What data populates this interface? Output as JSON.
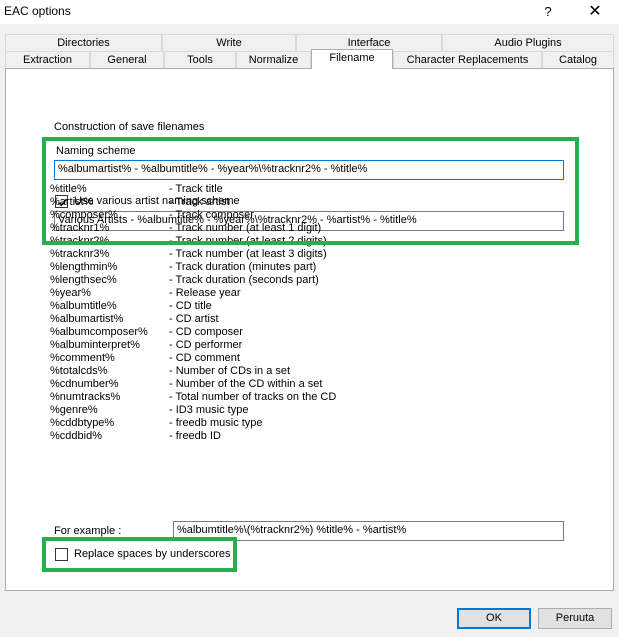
{
  "window": {
    "title": "EAC options",
    "help": "?",
    "close": "✕"
  },
  "tabs_top": [
    "Directories",
    "Write",
    "Interface",
    "Audio Plugins"
  ],
  "tabs_bottom": [
    "Extraction",
    "General",
    "Tools",
    "Normalize",
    "Filename",
    "Character Replacements",
    "Catalog"
  ],
  "filename": {
    "section_title": "Construction of save filenames",
    "naming_label": "Naming scheme",
    "naming_value": "%albumartist% - %albumtitle% - %year%\\%tracknr2% - %title%",
    "various_checked": true,
    "various_label": "Use various artist naming scheme",
    "various_value": "Various Artists - %albumtitle% - %year%\\%tracknr2% - %artist% - %title%",
    "variables": [
      {
        "name": "%title%",
        "desc": "- Track title"
      },
      {
        "name": "%artist%",
        "desc": "- Track artist"
      },
      {
        "name": "%composer%",
        "desc": "- Track composer"
      },
      {
        "name": "%tracknr1%",
        "desc": "- Track number (at least 1 digit)"
      },
      {
        "name": "%tracknr2%",
        "desc": "- Track number (at least 2 digits)"
      },
      {
        "name": "%tracknr3%",
        "desc": "- Track number (at least 3 digits)"
      },
      {
        "name": "%lengthmin%",
        "desc": "- Track duration (minutes part)"
      },
      {
        "name": "%lengthsec%",
        "desc": "- Track duration (seconds part)"
      },
      {
        "name": "%year%",
        "desc": "- Release year"
      },
      {
        "name": "%albumtitle%",
        "desc": "- CD title"
      },
      {
        "name": "%albumartist%",
        "desc": "- CD artist"
      },
      {
        "name": "%albumcomposer%",
        "desc": "- CD composer"
      },
      {
        "name": "%albuminterpret%",
        "desc": "- CD performer"
      },
      {
        "name": "%comment%",
        "desc": "- CD comment"
      },
      {
        "name": "%totalcds%",
        "desc": "- Number of CDs in a set"
      },
      {
        "name": "%cdnumber%",
        "desc": "- Number of the CD within a set"
      },
      {
        "name": "%numtracks%",
        "desc": "- Total number of tracks on the CD"
      },
      {
        "name": "%genre%",
        "desc": "- ID3 music type"
      },
      {
        "name": "%cddbtype%",
        "desc": "- freedb music type"
      },
      {
        "name": "%cddbid%",
        "desc": "- freedb ID"
      }
    ],
    "example_label": "For example :",
    "example_value": "%albumtitle%\\(%tracknr2%) %title% - %artist%",
    "replace_checked": false,
    "replace_label": "Replace spaces by underscores"
  },
  "buttons": {
    "ok": "OK",
    "cancel": "Peruuta"
  },
  "colors": {
    "highlight": "#22b14c",
    "focus": "#0078d7"
  }
}
